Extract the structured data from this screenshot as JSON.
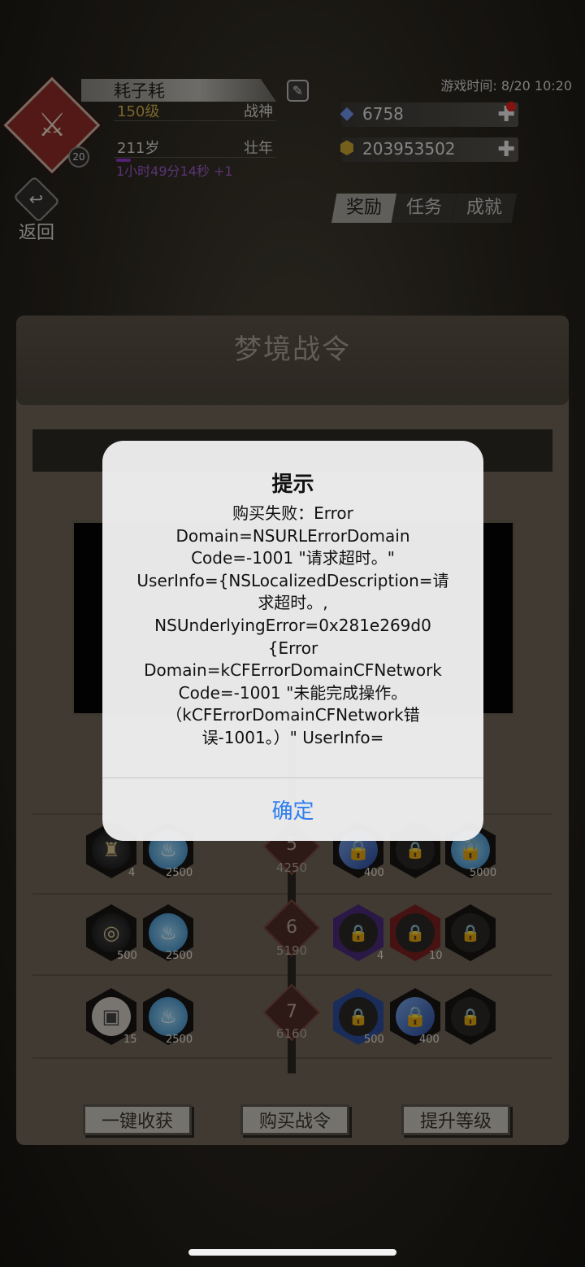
{
  "player": {
    "name": "耗子耗",
    "avatar_level": "20",
    "level": "150级",
    "title": "战神",
    "age": "211岁",
    "age_stage": "壮年",
    "timer": "1小时49分14秒 +1"
  },
  "hud": {
    "game_time": "游戏时间: 8/20 10:20",
    "gems": "6758",
    "coins": "203953502"
  },
  "nav": {
    "back": "返回",
    "tabs": [
      "奖励",
      "任务",
      "成就"
    ]
  },
  "panel": {
    "title": "梦境战令"
  },
  "rows": [
    {
      "num": "5",
      "pts": "4250",
      "left": [
        "4",
        "2500"
      ],
      "right": [
        "400",
        "",
        "5000"
      ]
    },
    {
      "num": "6",
      "pts": "5190",
      "left": [
        "500",
        "2500"
      ],
      "right": [
        "4",
        "10",
        ""
      ]
    },
    {
      "num": "7",
      "pts": "6160",
      "left": [
        "15",
        "2500"
      ],
      "right": [
        "500",
        "400",
        ""
      ]
    }
  ],
  "buttons": {
    "collect": "一键收获",
    "buy": "购买战令",
    "upgrade": "提升等级"
  },
  "alert": {
    "title": "提示",
    "lines": [
      "购买失败：Error",
      "Domain=NSURLErrorDomain",
      "Code=-1001 \"请求超时。\"",
      "UserInfo={NSLocalizedDescription=请",
      "求超时。,",
      "NSUnderlyingError=0x281e269d0",
      "{Error",
      "Domain=kCFErrorDomainCFNetwork",
      "Code=-1001 \"未能完成操作。",
      "（kCFErrorDomainCFNetwork错",
      "误-1001。）\" UserInfo="
    ],
    "ok": "确定"
  }
}
